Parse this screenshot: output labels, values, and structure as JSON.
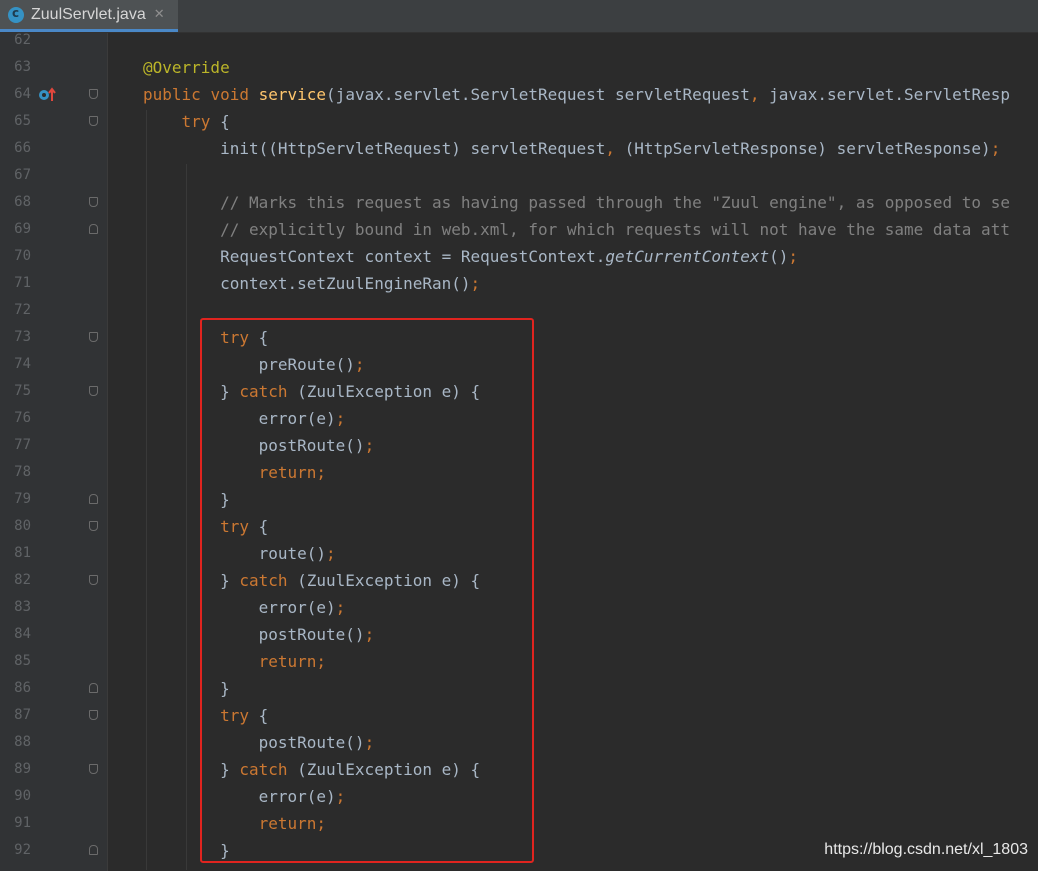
{
  "tab": {
    "title": "ZuulServlet.java",
    "close_symbol": "✕",
    "icon": "java-class-icon"
  },
  "lines": [
    {
      "n": "62",
      "fold": "",
      "segs": []
    },
    {
      "n": "63",
      "fold": "",
      "segs": [
        {
          "t": "@Override",
          "c": "ann"
        }
      ]
    },
    {
      "n": "64",
      "fold": "open",
      "marker": "override-marker-icon",
      "segs": [
        {
          "t": "public ",
          "c": "kw"
        },
        {
          "t": "void ",
          "c": "kw"
        },
        {
          "t": "service",
          "c": "fn"
        },
        {
          "t": "(javax.servlet.ServletRequest servletRequest",
          "c": ""
        },
        {
          "t": ", ",
          "c": "kw"
        },
        {
          "t": "javax.servlet.ServletResp",
          "c": ""
        }
      ]
    },
    {
      "n": "65",
      "fold": "open",
      "segs": [
        {
          "t": "    ",
          "c": ""
        },
        {
          "t": "try ",
          "c": "kw"
        },
        {
          "t": "{",
          "c": ""
        }
      ]
    },
    {
      "n": "66",
      "fold": "",
      "segs": [
        {
          "t": "        init((HttpServletRequest) servletRequest",
          "c": ""
        },
        {
          "t": ", ",
          "c": "kw"
        },
        {
          "t": "(HttpServletResponse) servletResponse)",
          "c": ""
        },
        {
          "t": ";",
          "c": "kw"
        }
      ]
    },
    {
      "n": "67",
      "fold": "",
      "segs": []
    },
    {
      "n": "68",
      "fold": "open",
      "segs": [
        {
          "t": "        // Marks this request as having passed through the \"Zuul engine\", as opposed to se",
          "c": "cm"
        }
      ]
    },
    {
      "n": "69",
      "fold": "close",
      "segs": [
        {
          "t": "        // explicitly bound in web.xml, for which requests will not have the same data att",
          "c": "cm"
        }
      ]
    },
    {
      "n": "70",
      "fold": "",
      "segs": [
        {
          "t": "        RequestContext context = RequestContext.",
          "c": ""
        },
        {
          "t": "getCurrentContext",
          "c": "it"
        },
        {
          "t": "()",
          "c": ""
        },
        {
          "t": ";",
          "c": "kw"
        }
      ]
    },
    {
      "n": "71",
      "fold": "",
      "segs": [
        {
          "t": "        context.setZuulEngineRan()",
          "c": ""
        },
        {
          "t": ";",
          "c": "kw"
        }
      ]
    },
    {
      "n": "72",
      "fold": "",
      "segs": []
    },
    {
      "n": "73",
      "fold": "open",
      "segs": [
        {
          "t": "        ",
          "c": ""
        },
        {
          "t": "try ",
          "c": "kw"
        },
        {
          "t": "{",
          "c": ""
        }
      ]
    },
    {
      "n": "74",
      "fold": "",
      "segs": [
        {
          "t": "            preRoute()",
          "c": ""
        },
        {
          "t": ";",
          "c": "kw"
        }
      ]
    },
    {
      "n": "75",
      "fold": "open",
      "segs": [
        {
          "t": "        } ",
          "c": ""
        },
        {
          "t": "catch ",
          "c": "kw"
        },
        {
          "t": "(ZuulException e) {",
          "c": ""
        }
      ]
    },
    {
      "n": "76",
      "fold": "",
      "segs": [
        {
          "t": "            error(e)",
          "c": ""
        },
        {
          "t": ";",
          "c": "kw"
        }
      ]
    },
    {
      "n": "77",
      "fold": "",
      "segs": [
        {
          "t": "            postRoute()",
          "c": ""
        },
        {
          "t": ";",
          "c": "kw"
        }
      ]
    },
    {
      "n": "78",
      "fold": "",
      "segs": [
        {
          "t": "            ",
          "c": ""
        },
        {
          "t": "return;",
          "c": "kw"
        }
      ]
    },
    {
      "n": "79",
      "fold": "close",
      "segs": [
        {
          "t": "        }",
          "c": ""
        }
      ]
    },
    {
      "n": "80",
      "fold": "open",
      "segs": [
        {
          "t": "        ",
          "c": ""
        },
        {
          "t": "try ",
          "c": "kw"
        },
        {
          "t": "{",
          "c": ""
        }
      ]
    },
    {
      "n": "81",
      "fold": "",
      "segs": [
        {
          "t": "            route()",
          "c": ""
        },
        {
          "t": ";",
          "c": "kw"
        }
      ]
    },
    {
      "n": "82",
      "fold": "open",
      "segs": [
        {
          "t": "        } ",
          "c": ""
        },
        {
          "t": "catch ",
          "c": "kw"
        },
        {
          "t": "(ZuulException e) {",
          "c": ""
        }
      ]
    },
    {
      "n": "83",
      "fold": "",
      "segs": [
        {
          "t": "            error(e)",
          "c": ""
        },
        {
          "t": ";",
          "c": "kw"
        }
      ]
    },
    {
      "n": "84",
      "fold": "",
      "segs": [
        {
          "t": "            postRoute()",
          "c": ""
        },
        {
          "t": ";",
          "c": "kw"
        }
      ]
    },
    {
      "n": "85",
      "fold": "",
      "segs": [
        {
          "t": "            ",
          "c": ""
        },
        {
          "t": "return;",
          "c": "kw"
        }
      ]
    },
    {
      "n": "86",
      "fold": "close",
      "segs": [
        {
          "t": "        }",
          "c": ""
        }
      ]
    },
    {
      "n": "87",
      "fold": "open",
      "segs": [
        {
          "t": "        ",
          "c": ""
        },
        {
          "t": "try ",
          "c": "kw"
        },
        {
          "t": "{",
          "c": ""
        }
      ]
    },
    {
      "n": "88",
      "fold": "",
      "segs": [
        {
          "t": "            postRoute()",
          "c": ""
        },
        {
          "t": ";",
          "c": "kw"
        }
      ]
    },
    {
      "n": "89",
      "fold": "open",
      "segs": [
        {
          "t": "        } ",
          "c": ""
        },
        {
          "t": "catch ",
          "c": "kw"
        },
        {
          "t": "(ZuulException e) {",
          "c": ""
        }
      ]
    },
    {
      "n": "90",
      "fold": "",
      "segs": [
        {
          "t": "            error(e)",
          "c": ""
        },
        {
          "t": ";",
          "c": "kw"
        }
      ]
    },
    {
      "n": "91",
      "fold": "",
      "segs": [
        {
          "t": "            ",
          "c": ""
        },
        {
          "t": "return;",
          "c": "kw"
        }
      ]
    },
    {
      "n": "92",
      "fold": "close",
      "segs": [
        {
          "t": "        }",
          "c": ""
        }
      ]
    }
  ],
  "watermark": "https://blog.csdn.net/xl_1803",
  "colors": {
    "background": "#2b2b2b",
    "keyword": "#cc7832",
    "annotation": "#bbb529",
    "method": "#ffc66d",
    "comment": "#808080",
    "text": "#a9b7c6",
    "highlight_box": "#e0241f"
  }
}
